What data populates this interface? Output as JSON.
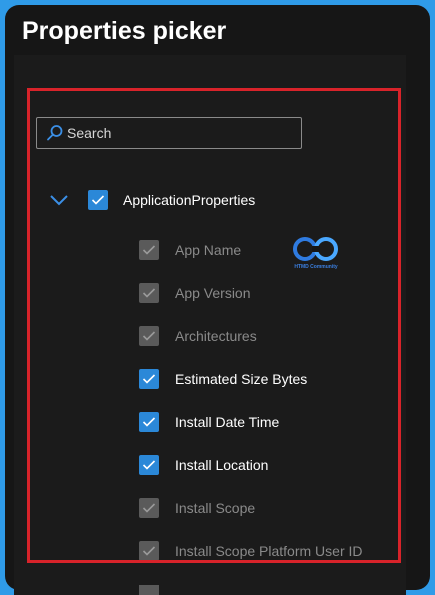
{
  "title": "Properties picker",
  "search": {
    "placeholder": "Search",
    "value": ""
  },
  "group": {
    "label": "ApplicationProperties",
    "checked": true,
    "expanded": true
  },
  "watermark": {
    "text": "HTMD Community"
  },
  "items": [
    {
      "label": "App Name",
      "checked": true,
      "disabled": true
    },
    {
      "label": "App Version",
      "checked": true,
      "disabled": true
    },
    {
      "label": "Architectures",
      "checked": true,
      "disabled": true
    },
    {
      "label": "Estimated Size Bytes",
      "checked": true,
      "disabled": false
    },
    {
      "label": "Install Date Time",
      "checked": true,
      "disabled": false
    },
    {
      "label": "Install Location",
      "checked": true,
      "disabled": false
    },
    {
      "label": "Install Scope",
      "checked": true,
      "disabled": true
    },
    {
      "label": "Install Scope Platform User ID",
      "checked": true,
      "disabled": true
    }
  ],
  "colors": {
    "accent": "#2b88d8",
    "highlight_border": "#d8232a",
    "disabled": "#5a5a5a"
  }
}
